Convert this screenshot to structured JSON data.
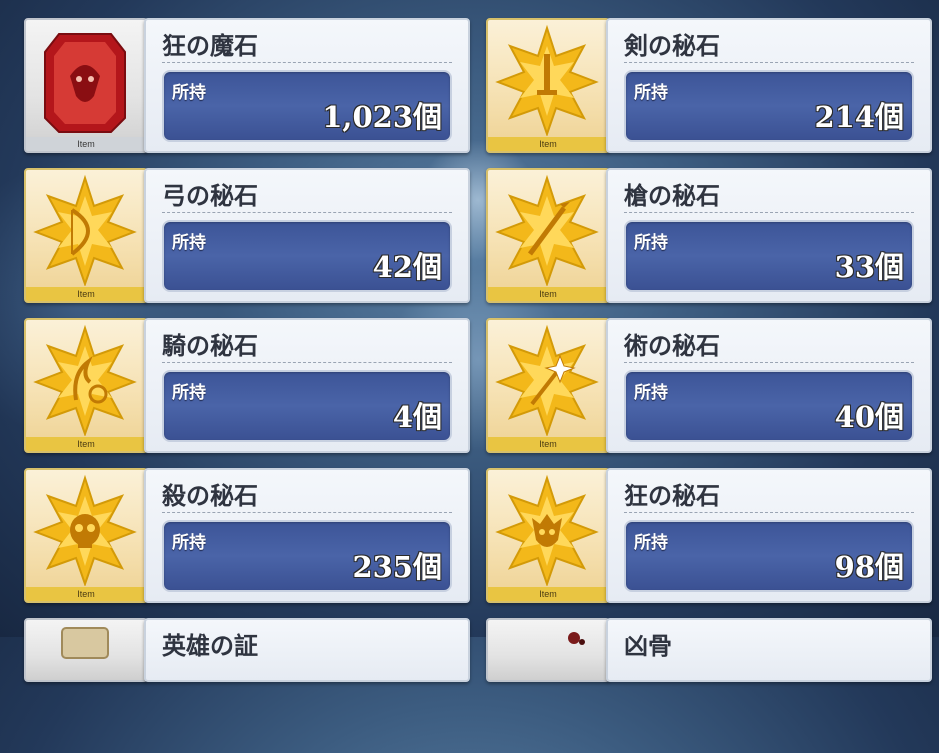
{
  "thumb_caption": "Item",
  "owned_label": "所持",
  "colors": {
    "panel": "#eef2f8",
    "bar": "#4560a4",
    "gold_label": "#e9c542",
    "silver_label": "#cfd3d8",
    "stone_gold": "#f3b81a",
    "stone_red": "#b4161b"
  },
  "items": [
    {
      "name": "狂の魔石",
      "count": "1,023個",
      "icon": "red-gem-icon"
    },
    {
      "name": "剣の秘石",
      "count": "214個",
      "icon": "sword-star-gem-icon"
    },
    {
      "name": "弓の秘石",
      "count": "42個",
      "icon": "bow-star-gem-icon"
    },
    {
      "name": "槍の秘石",
      "count": "33個",
      "icon": "lance-star-gem-icon"
    },
    {
      "name": "騎の秘石",
      "count": "4個",
      "icon": "rider-star-gem-icon"
    },
    {
      "name": "術の秘石",
      "count": "40個",
      "icon": "caster-star-gem-icon"
    },
    {
      "name": "殺の秘石",
      "count": "235個",
      "icon": "assassin-star-gem-icon"
    },
    {
      "name": "狂の秘石",
      "count": "98個",
      "icon": "berserker-star-gem-icon"
    },
    {
      "name": "英雄の証",
      "icon": "hero-proof-icon"
    },
    {
      "name": "凶骨",
      "icon": "bone-icon"
    }
  ]
}
